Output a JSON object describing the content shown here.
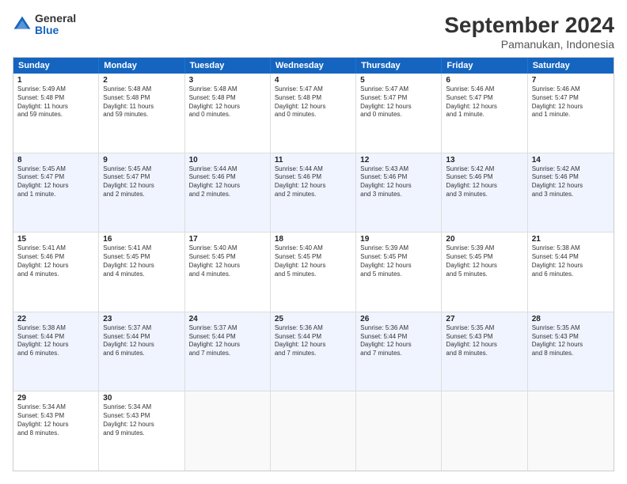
{
  "logo": {
    "general": "General",
    "blue": "Blue"
  },
  "header": {
    "month": "September 2024",
    "location": "Pamanukan, Indonesia"
  },
  "days": [
    "Sunday",
    "Monday",
    "Tuesday",
    "Wednesday",
    "Thursday",
    "Friday",
    "Saturday"
  ],
  "rows": [
    [
      {
        "day": "",
        "info": ""
      },
      {
        "day": "2",
        "info": "Sunrise: 5:48 AM\nSunset: 5:48 PM\nDaylight: 11 hours\nand 59 minutes."
      },
      {
        "day": "3",
        "info": "Sunrise: 5:48 AM\nSunset: 5:48 PM\nDaylight: 12 hours\nand 0 minutes."
      },
      {
        "day": "4",
        "info": "Sunrise: 5:47 AM\nSunset: 5:48 PM\nDaylight: 12 hours\nand 0 minutes."
      },
      {
        "day": "5",
        "info": "Sunrise: 5:47 AM\nSunset: 5:47 PM\nDaylight: 12 hours\nand 0 minutes."
      },
      {
        "day": "6",
        "info": "Sunrise: 5:46 AM\nSunset: 5:47 PM\nDaylight: 12 hours\nand 1 minute."
      },
      {
        "day": "7",
        "info": "Sunrise: 5:46 AM\nSunset: 5:47 PM\nDaylight: 12 hours\nand 1 minute."
      }
    ],
    [
      {
        "day": "1",
        "info": "Sunrise: 5:49 AM\nSunset: 5:48 PM\nDaylight: 11 hours\nand 59 minutes.",
        "first": true
      },
      null,
      null,
      null,
      null,
      null,
      null
    ],
    [
      {
        "day": "8",
        "info": "Sunrise: 5:45 AM\nSunset: 5:47 PM\nDaylight: 12 hours\nand 1 minute."
      },
      {
        "day": "9",
        "info": "Sunrise: 5:45 AM\nSunset: 5:47 PM\nDaylight: 12 hours\nand 2 minutes."
      },
      {
        "day": "10",
        "info": "Sunrise: 5:44 AM\nSunset: 5:46 PM\nDaylight: 12 hours\nand 2 minutes."
      },
      {
        "day": "11",
        "info": "Sunrise: 5:44 AM\nSunset: 5:46 PM\nDaylight: 12 hours\nand 2 minutes."
      },
      {
        "day": "12",
        "info": "Sunrise: 5:43 AM\nSunset: 5:46 PM\nDaylight: 12 hours\nand 3 minutes."
      },
      {
        "day": "13",
        "info": "Sunrise: 5:42 AM\nSunset: 5:46 PM\nDaylight: 12 hours\nand 3 minutes."
      },
      {
        "day": "14",
        "info": "Sunrise: 5:42 AM\nSunset: 5:46 PM\nDaylight: 12 hours\nand 3 minutes."
      }
    ],
    [
      {
        "day": "15",
        "info": "Sunrise: 5:41 AM\nSunset: 5:46 PM\nDaylight: 12 hours\nand 4 minutes."
      },
      {
        "day": "16",
        "info": "Sunrise: 5:41 AM\nSunset: 5:45 PM\nDaylight: 12 hours\nand 4 minutes."
      },
      {
        "day": "17",
        "info": "Sunrise: 5:40 AM\nSunset: 5:45 PM\nDaylight: 12 hours\nand 4 minutes."
      },
      {
        "day": "18",
        "info": "Sunrise: 5:40 AM\nSunset: 5:45 PM\nDaylight: 12 hours\nand 5 minutes."
      },
      {
        "day": "19",
        "info": "Sunrise: 5:39 AM\nSunset: 5:45 PM\nDaylight: 12 hours\nand 5 minutes."
      },
      {
        "day": "20",
        "info": "Sunrise: 5:39 AM\nSunset: 5:45 PM\nDaylight: 12 hours\nand 5 minutes."
      },
      {
        "day": "21",
        "info": "Sunrise: 5:38 AM\nSunset: 5:44 PM\nDaylight: 12 hours\nand 6 minutes."
      }
    ],
    [
      {
        "day": "22",
        "info": "Sunrise: 5:38 AM\nSunset: 5:44 PM\nDaylight: 12 hours\nand 6 minutes."
      },
      {
        "day": "23",
        "info": "Sunrise: 5:37 AM\nSunset: 5:44 PM\nDaylight: 12 hours\nand 6 minutes."
      },
      {
        "day": "24",
        "info": "Sunrise: 5:37 AM\nSunset: 5:44 PM\nDaylight: 12 hours\nand 7 minutes."
      },
      {
        "day": "25",
        "info": "Sunrise: 5:36 AM\nSunset: 5:44 PM\nDaylight: 12 hours\nand 7 minutes."
      },
      {
        "day": "26",
        "info": "Sunrise: 5:36 AM\nSunset: 5:44 PM\nDaylight: 12 hours\nand 7 minutes."
      },
      {
        "day": "27",
        "info": "Sunrise: 5:35 AM\nSunset: 5:43 PM\nDaylight: 12 hours\nand 8 minutes."
      },
      {
        "day": "28",
        "info": "Sunrise: 5:35 AM\nSunset: 5:43 PM\nDaylight: 12 hours\nand 8 minutes."
      }
    ],
    [
      {
        "day": "29",
        "info": "Sunrise: 5:34 AM\nSunset: 5:43 PM\nDaylight: 12 hours\nand 8 minutes."
      },
      {
        "day": "30",
        "info": "Sunrise: 5:34 AM\nSunset: 5:43 PM\nDaylight: 12 hours\nand 9 minutes."
      },
      {
        "day": "",
        "info": ""
      },
      {
        "day": "",
        "info": ""
      },
      {
        "day": "",
        "info": ""
      },
      {
        "day": "",
        "info": ""
      },
      {
        "day": "",
        "info": ""
      }
    ]
  ],
  "calendar_rows": [
    {
      "cells": [
        {
          "day": "1",
          "info": "Sunrise: 5:49 AM\nSunset: 5:48 PM\nDaylight: 11 hours\nand 59 minutes.",
          "empty": false
        },
        {
          "day": "2",
          "info": "Sunrise: 5:48 AM\nSunset: 5:48 PM\nDaylight: 11 hours\nand 59 minutes.",
          "empty": false
        },
        {
          "day": "3",
          "info": "Sunrise: 5:48 AM\nSunset: 5:48 PM\nDaylight: 12 hours\nand 0 minutes.",
          "empty": false
        },
        {
          "day": "4",
          "info": "Sunrise: 5:47 AM\nSunset: 5:48 PM\nDaylight: 12 hours\nand 0 minutes.",
          "empty": false
        },
        {
          "day": "5",
          "info": "Sunrise: 5:47 AM\nSunset: 5:47 PM\nDaylight: 12 hours\nand 0 minutes.",
          "empty": false
        },
        {
          "day": "6",
          "info": "Sunrise: 5:46 AM\nSunset: 5:47 PM\nDaylight: 12 hours\nand 1 minute.",
          "empty": false
        },
        {
          "day": "7",
          "info": "Sunrise: 5:46 AM\nSunset: 5:47 PM\nDaylight: 12 hours\nand 1 minute.",
          "empty": false
        }
      ],
      "alt": false
    },
    {
      "cells": [
        {
          "day": "8",
          "info": "Sunrise: 5:45 AM\nSunset: 5:47 PM\nDaylight: 12 hours\nand 1 minute.",
          "empty": false
        },
        {
          "day": "9",
          "info": "Sunrise: 5:45 AM\nSunset: 5:47 PM\nDaylight: 12 hours\nand 2 minutes.",
          "empty": false
        },
        {
          "day": "10",
          "info": "Sunrise: 5:44 AM\nSunset: 5:46 PM\nDaylight: 12 hours\nand 2 minutes.",
          "empty": false
        },
        {
          "day": "11",
          "info": "Sunrise: 5:44 AM\nSunset: 5:46 PM\nDaylight: 12 hours\nand 2 minutes.",
          "empty": false
        },
        {
          "day": "12",
          "info": "Sunrise: 5:43 AM\nSunset: 5:46 PM\nDaylight: 12 hours\nand 3 minutes.",
          "empty": false
        },
        {
          "day": "13",
          "info": "Sunrise: 5:42 AM\nSunset: 5:46 PM\nDaylight: 12 hours\nand 3 minutes.",
          "empty": false
        },
        {
          "day": "14",
          "info": "Sunrise: 5:42 AM\nSunset: 5:46 PM\nDaylight: 12 hours\nand 3 minutes.",
          "empty": false
        }
      ],
      "alt": true
    },
    {
      "cells": [
        {
          "day": "15",
          "info": "Sunrise: 5:41 AM\nSunset: 5:46 PM\nDaylight: 12 hours\nand 4 minutes.",
          "empty": false
        },
        {
          "day": "16",
          "info": "Sunrise: 5:41 AM\nSunset: 5:45 PM\nDaylight: 12 hours\nand 4 minutes.",
          "empty": false
        },
        {
          "day": "17",
          "info": "Sunrise: 5:40 AM\nSunset: 5:45 PM\nDaylight: 12 hours\nand 4 minutes.",
          "empty": false
        },
        {
          "day": "18",
          "info": "Sunrise: 5:40 AM\nSunset: 5:45 PM\nDaylight: 12 hours\nand 5 minutes.",
          "empty": false
        },
        {
          "day": "19",
          "info": "Sunrise: 5:39 AM\nSunset: 5:45 PM\nDaylight: 12 hours\nand 5 minutes.",
          "empty": false
        },
        {
          "day": "20",
          "info": "Sunrise: 5:39 AM\nSunset: 5:45 PM\nDaylight: 12 hours\nand 5 minutes.",
          "empty": false
        },
        {
          "day": "21",
          "info": "Sunrise: 5:38 AM\nSunset: 5:44 PM\nDaylight: 12 hours\nand 6 minutes.",
          "empty": false
        }
      ],
      "alt": false
    },
    {
      "cells": [
        {
          "day": "22",
          "info": "Sunrise: 5:38 AM\nSunset: 5:44 PM\nDaylight: 12 hours\nand 6 minutes.",
          "empty": false
        },
        {
          "day": "23",
          "info": "Sunrise: 5:37 AM\nSunset: 5:44 PM\nDaylight: 12 hours\nand 6 minutes.",
          "empty": false
        },
        {
          "day": "24",
          "info": "Sunrise: 5:37 AM\nSunset: 5:44 PM\nDaylight: 12 hours\nand 7 minutes.",
          "empty": false
        },
        {
          "day": "25",
          "info": "Sunrise: 5:36 AM\nSunset: 5:44 PM\nDaylight: 12 hours\nand 7 minutes.",
          "empty": false
        },
        {
          "day": "26",
          "info": "Sunrise: 5:36 AM\nSunset: 5:44 PM\nDaylight: 12 hours\nand 7 minutes.",
          "empty": false
        },
        {
          "day": "27",
          "info": "Sunrise: 5:35 AM\nSunset: 5:43 PM\nDaylight: 12 hours\nand 8 minutes.",
          "empty": false
        },
        {
          "day": "28",
          "info": "Sunrise: 5:35 AM\nSunset: 5:43 PM\nDaylight: 12 hours\nand 8 minutes.",
          "empty": false
        }
      ],
      "alt": true
    },
    {
      "cells": [
        {
          "day": "29",
          "info": "Sunrise: 5:34 AM\nSunset: 5:43 PM\nDaylight: 12 hours\nand 8 minutes.",
          "empty": false
        },
        {
          "day": "30",
          "info": "Sunrise: 5:34 AM\nSunset: 5:43 PM\nDaylight: 12 hours\nand 9 minutes.",
          "empty": false
        },
        {
          "day": "",
          "info": "",
          "empty": true
        },
        {
          "day": "",
          "info": "",
          "empty": true
        },
        {
          "day": "",
          "info": "",
          "empty": true
        },
        {
          "day": "",
          "info": "",
          "empty": true
        },
        {
          "day": "",
          "info": "",
          "empty": true
        }
      ],
      "alt": false
    }
  ]
}
